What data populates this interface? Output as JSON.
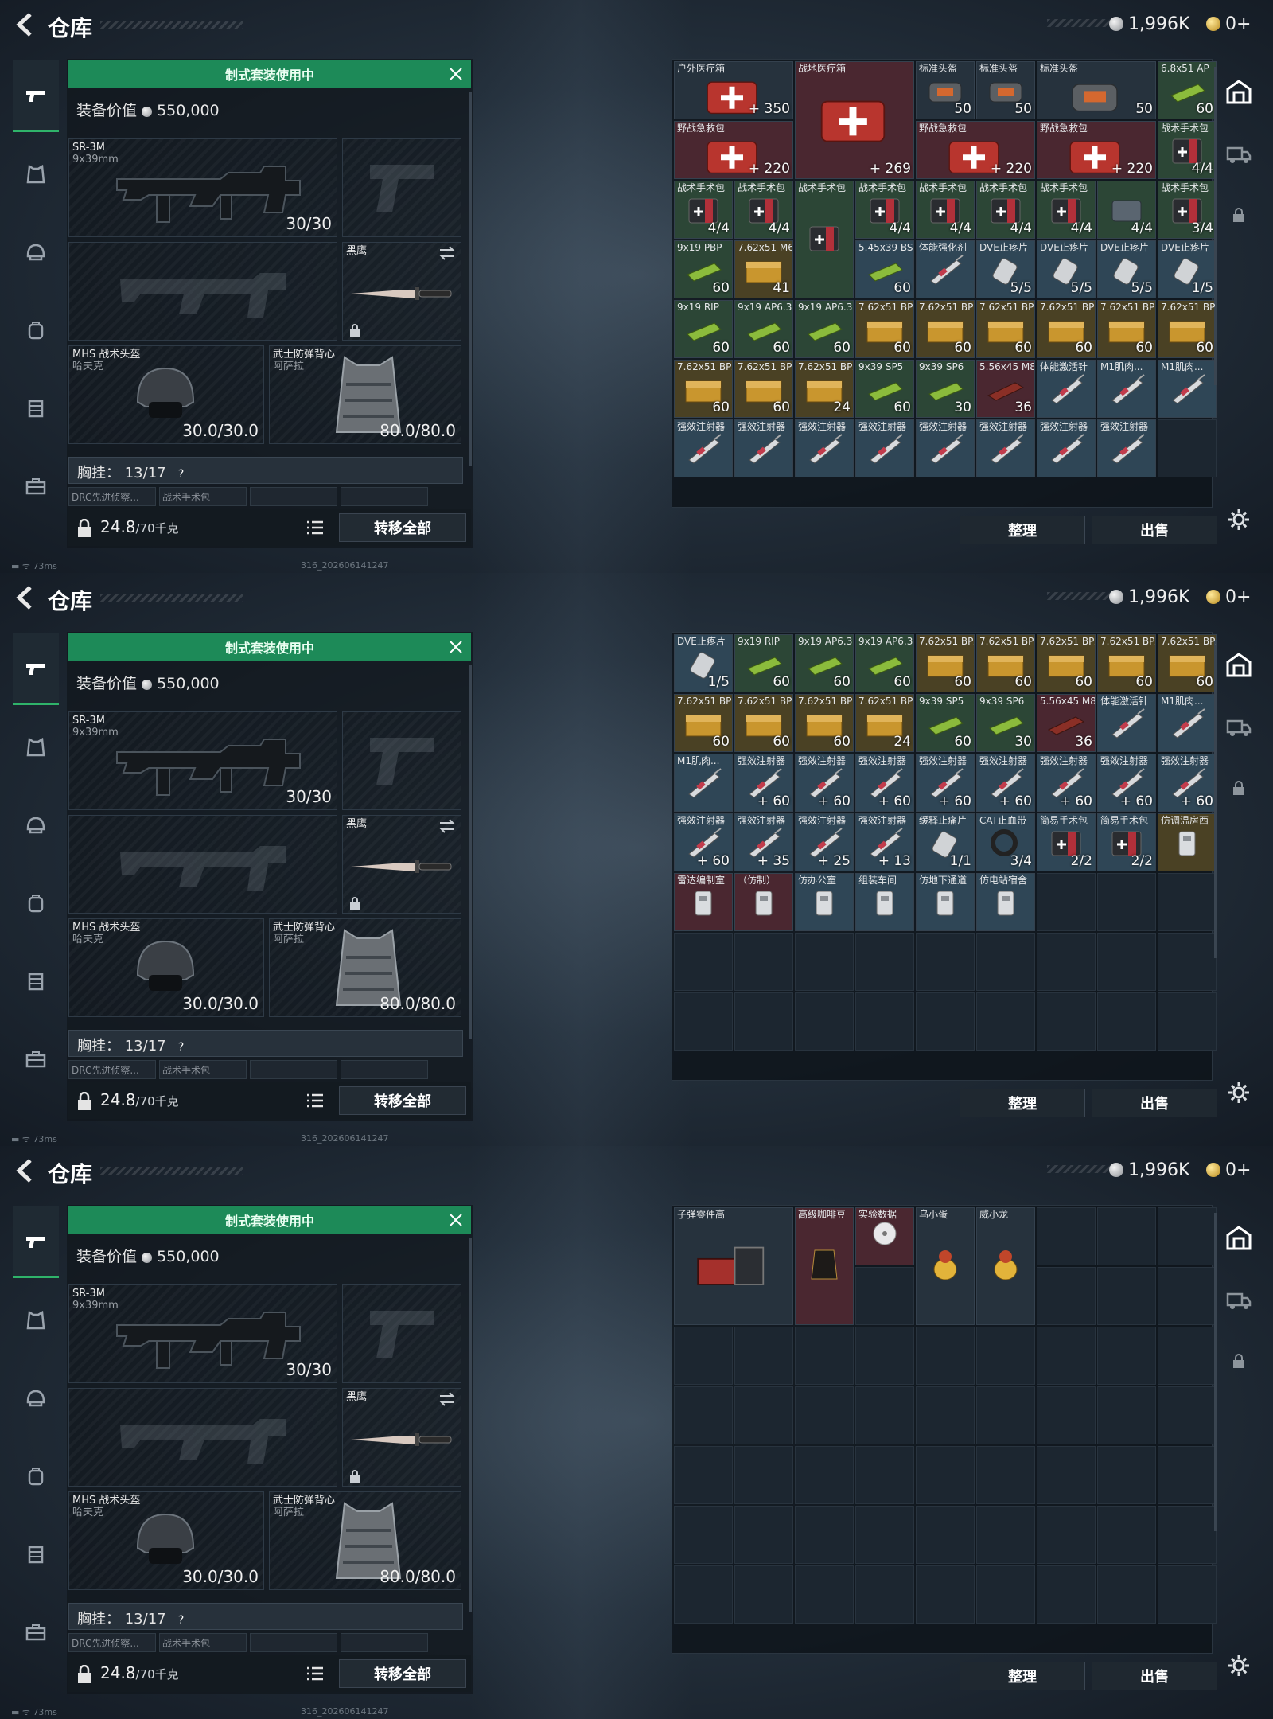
{
  "header": {
    "title": "仓库",
    "silver": "1,996K",
    "gold": "0+"
  },
  "loadout": {
    "banner": "制式套装使用中",
    "equip_value_label": "装备价值",
    "equip_value": "550,000",
    "primary": {
      "name": "SR-3M",
      "sub": "9x39mm",
      "ammo": "30/30"
    },
    "melee": {
      "name": "黑鹰"
    },
    "helmet": {
      "name": "MHS 战术头盔",
      "sub": "哈夫克",
      "durability": "30.0/30.0"
    },
    "armor": {
      "name": "武士防弹背心",
      "sub": "阿萨拉",
      "durability": "80.0/80.0"
    },
    "chest": {
      "label": "胸挂：",
      "value": "13/17",
      "help": "?"
    },
    "chest_items": [
      "DRC先进侦察...",
      "战术手术包"
    ],
    "weight": "24.8",
    "weight_max": "/70千克",
    "transfer_label": "转移全部"
  },
  "status": {
    "ping": "73ms",
    "build": "316_202606141247"
  },
  "actions": {
    "sort": "整理",
    "sell": "出售"
  },
  "screens": [
    {
      "items": [
        {
          "n": "户外医疗箱",
          "v": "+ 350",
          "c": "gray",
          "s": "big"
        },
        {
          "n": "战地医疗箱",
          "v": "+ 269",
          "c": "red",
          "s": "bigtall"
        },
        {
          "n": "标准头盔",
          "v": "50",
          "c": "gray"
        },
        {
          "n": "标准头盔",
          "v": "50",
          "c": "gray"
        },
        {
          "n": "标准头盔",
          "v": "50",
          "c": "gray",
          "s": "big"
        },
        {
          "n": "6.8x51 AP",
          "v": "60",
          "c": "green"
        },
        {
          "n": "野战急救包",
          "v": "+ 220",
          "c": "red",
          "s": "big"
        },
        {
          "n": "野战急救包",
          "v": "+ 220",
          "c": "red",
          "s": "big"
        },
        {
          "n": "野战急救包",
          "v": "+ 220",
          "c": "red",
          "s": "big"
        },
        {
          "n": "战术手术包",
          "v": "4/4",
          "c": "green"
        },
        {
          "n": "战术手术包",
          "v": "4/4",
          "c": "green"
        },
        {
          "n": "战术手术包",
          "v": "4/4",
          "c": "green"
        },
        {
          "n": "战术手术包",
          "v": "",
          "c": "green",
          "s": "tall"
        },
        {
          "n": "战术手术包",
          "v": "4/4",
          "c": "green"
        },
        {
          "n": "战术手术包",
          "v": "4/4",
          "c": "green"
        },
        {
          "n": "战术手术包",
          "v": "4/4",
          "c": "green"
        },
        {
          "n": "战术手术包",
          "v": "4/4",
          "c": "green"
        },
        {
          "n": "",
          "v": "4/4",
          "c": "green"
        },
        {
          "n": "战术手术包",
          "v": "3/4",
          "c": "green"
        },
        {
          "n": "9x19 PBP",
          "v": "60",
          "c": "green"
        },
        {
          "n": "7.62x51 M62",
          "v": "41",
          "c": "gold"
        },
        {
          "n": "5.45x39 BS",
          "v": "60",
          "c": "blue"
        },
        {
          "n": "体能强化剂",
          "v": "",
          "c": "blue"
        },
        {
          "n": "DVE止疼片",
          "v": "5/5",
          "c": "blue"
        },
        {
          "n": "DVE止疼片",
          "v": "5/5",
          "c": "blue"
        },
        {
          "n": "DVE止疼片",
          "v": "5/5",
          "c": "blue"
        },
        {
          "n": "DVE止疼片",
          "v": "1/5",
          "c": "blue"
        },
        {
          "n": "9x19 RIP",
          "v": "60",
          "c": "green"
        },
        {
          "n": "9x19 AP6.3",
          "v": "60",
          "c": "green"
        },
        {
          "n": "9x19 AP6.3",
          "v": "60",
          "c": "green"
        },
        {
          "n": "7.62x51 BPZ",
          "v": "60",
          "c": "gold"
        },
        {
          "n": "7.62x51 BPZ",
          "v": "60",
          "c": "gold"
        },
        {
          "n": "7.62x51 BPZ",
          "v": "60",
          "c": "gold"
        },
        {
          "n": "7.62x51 BPZ",
          "v": "60",
          "c": "gold"
        },
        {
          "n": "7.62x51 BPZ",
          "v": "60",
          "c": "gold"
        },
        {
          "n": "7.62x51 BPZ",
          "v": "60",
          "c": "gold"
        },
        {
          "n": "7.62x51 BPZ",
          "v": "60",
          "c": "gold"
        },
        {
          "n": "7.62x51 BPZ",
          "v": "60",
          "c": "gold"
        },
        {
          "n": "7.62x51 BPZ",
          "v": "24",
          "c": "gold"
        },
        {
          "n": "9x39 SP5",
          "v": "60",
          "c": "green"
        },
        {
          "n": "9x39 SP6",
          "v": "30",
          "c": "green"
        },
        {
          "n": "5.56x45 M855",
          "v": "36",
          "c": "red"
        },
        {
          "n": "体能激活针",
          "v": "",
          "c": "blue"
        },
        {
          "n": "M1肌肉...",
          "v": "",
          "c": "blue"
        },
        {
          "n": "M1肌肉...",
          "v": "",
          "c": "blue"
        },
        {
          "n": "强效注射器",
          "v": "",
          "c": "blue"
        },
        {
          "n": "强效注射器",
          "v": "",
          "c": "blue"
        },
        {
          "n": "强效注射器",
          "v": "",
          "c": "blue"
        },
        {
          "n": "强效注射器",
          "v": "",
          "c": "blue"
        },
        {
          "n": "强效注射器",
          "v": "",
          "c": "blue"
        },
        {
          "n": "强效注射器",
          "v": "",
          "c": "blue"
        },
        {
          "n": "强效注射器",
          "v": "",
          "c": "blue"
        },
        {
          "n": "强效注射器",
          "v": "",
          "c": "blue"
        }
      ]
    },
    {
      "items": [
        {
          "n": "DVE止疼片",
          "v": "1/5",
          "c": "blue"
        },
        {
          "n": "9x19 RIP",
          "v": "60",
          "c": "green"
        },
        {
          "n": "9x19 AP6.3",
          "v": "60",
          "c": "green"
        },
        {
          "n": "9x19 AP6.3",
          "v": "60",
          "c": "green"
        },
        {
          "n": "7.62x51 BPZ",
          "v": "60",
          "c": "gold"
        },
        {
          "n": "7.62x51 BPZ",
          "v": "60",
          "c": "gold"
        },
        {
          "n": "7.62x51 BPZ",
          "v": "60",
          "c": "gold"
        },
        {
          "n": "7.62x51 BPZ",
          "v": "60",
          "c": "gold"
        },
        {
          "n": "7.62x51 BPZ",
          "v": "60",
          "c": "gold"
        },
        {
          "n": "7.62x51 BPZ",
          "v": "60",
          "c": "gold"
        },
        {
          "n": "7.62x51 BPZ",
          "v": "60",
          "c": "gold"
        },
        {
          "n": "7.62x51 BPZ",
          "v": "60",
          "c": "gold"
        },
        {
          "n": "7.62x51 BPZ",
          "v": "24",
          "c": "gold"
        },
        {
          "n": "9x39 SP5",
          "v": "60",
          "c": "green"
        },
        {
          "n": "9x39 SP6",
          "v": "30",
          "c": "green"
        },
        {
          "n": "5.56x45 M855",
          "v": "36",
          "c": "red"
        },
        {
          "n": "体能激活针",
          "v": "",
          "c": "blue"
        },
        {
          "n": "M1肌肉...",
          "v": "",
          "c": "blue"
        },
        {
          "n": "M1肌肉...",
          "v": "",
          "c": "blue"
        },
        {
          "n": "强效注射器",
          "v": "+ 60",
          "c": "blue"
        },
        {
          "n": "强效注射器",
          "v": "+ 60",
          "c": "blue"
        },
        {
          "n": "强效注射器",
          "v": "+ 60",
          "c": "blue"
        },
        {
          "n": "强效注射器",
          "v": "+ 60",
          "c": "blue"
        },
        {
          "n": "强效注射器",
          "v": "+ 60",
          "c": "blue"
        },
        {
          "n": "强效注射器",
          "v": "+ 60",
          "c": "blue"
        },
        {
          "n": "强效注射器",
          "v": "+ 60",
          "c": "blue"
        },
        {
          "n": "强效注射器",
          "v": "+ 60",
          "c": "blue"
        },
        {
          "n": "强效注射器",
          "v": "+ 60",
          "c": "blue"
        },
        {
          "n": "强效注射器",
          "v": "+ 35",
          "c": "blue"
        },
        {
          "n": "强效注射器",
          "v": "+ 25",
          "c": "blue"
        },
        {
          "n": "强效注射器",
          "v": "+ 13",
          "c": "blue"
        },
        {
          "n": "缓释止痛片",
          "v": "1/1",
          "c": "blue"
        },
        {
          "n": "CAT止血带",
          "v": "3/4",
          "c": "blue"
        },
        {
          "n": "简易手术包",
          "v": "2/2",
          "c": "blue"
        },
        {
          "n": "简易手术包",
          "v": "2/2",
          "c": "blue"
        },
        {
          "n": "仿调温房西",
          "v": "",
          "c": "gold"
        },
        {
          "n": "雷达编制室",
          "v": "",
          "c": "red"
        },
        {
          "n": "（仿制）",
          "v": "",
          "c": "red"
        },
        {
          "n": "仿办公室",
          "v": "",
          "c": "blue"
        },
        {
          "n": "组装车间",
          "v": "",
          "c": "blue"
        },
        {
          "n": "仿地下通道",
          "v": "",
          "c": "blue"
        },
        {
          "n": "仿电站宿舍",
          "v": "",
          "c": "blue"
        }
      ]
    },
    {
      "items": [
        {
          "n": "子弹零件高",
          "v": "",
          "c": "gray",
          "s": "bigtall"
        },
        {
          "n": "高级咖啡豆",
          "v": "",
          "c": "red",
          "s": "tall"
        },
        {
          "n": "实验数据",
          "v": "",
          "c": "red"
        },
        {
          "n": "乌小蛋",
          "v": "",
          "c": "gray",
          "s": "tall"
        },
        {
          "n": "威小龙",
          "v": "",
          "c": "gray",
          "s": "tall"
        }
      ]
    }
  ]
}
